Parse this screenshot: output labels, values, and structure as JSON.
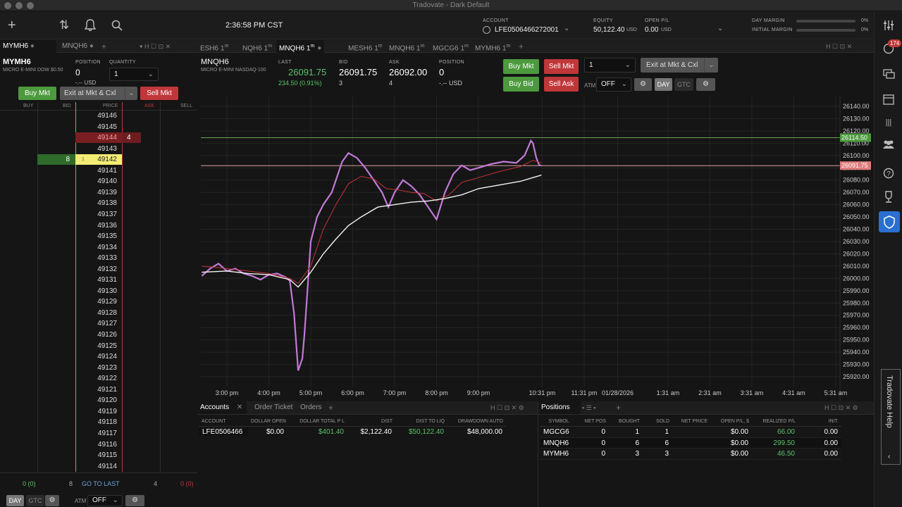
{
  "window": {
    "title": "Tradovate - Dark Default"
  },
  "topbar": {
    "clock": "2:36:58 PM CST",
    "account_label": "ACCOUNT",
    "account_value": "LFE0506466272001",
    "equity_label": "EQUITY",
    "equity_value": "50,122.40",
    "equity_unit": "USD",
    "openpl_label": "OPEN P/L",
    "openpl_value": "0.00",
    "openpl_unit": "USD",
    "day_margin_label": "DAY MARGIN",
    "day_margin_pct": "0%",
    "initial_margin_label": "INITIAL MARGIN",
    "initial_margin_pct": "0%"
  },
  "rightbar": {
    "badge": "174",
    "help_label": "Tradovate Help"
  },
  "left_tabs": [
    {
      "label": "MYMH6",
      "active": true
    },
    {
      "label": "MNQH6",
      "active": false
    }
  ],
  "order_panel": {
    "symbol": "MYMH6",
    "subtitle": "MICRO E-MINI DOW $0.50",
    "position_label": "POSITION",
    "position_value": "0",
    "position_usd": "-.-- USD",
    "quantity_label": "QUANTITY",
    "quantity_value": "1",
    "buy_mkt": "Buy Mkt",
    "exit_cxl": "Exit at Mkt & Cxl",
    "sell_mkt": "Sell Mkt"
  },
  "dom": {
    "headers": {
      "buy": "BUY",
      "bid": "BID",
      "price": "PRICE",
      "ask": "ASK",
      "sell": "SELL"
    },
    "prices": [
      "49146",
      "49145",
      "49144",
      "49143",
      "49142",
      "49141",
      "49140",
      "49139",
      "49138",
      "49137",
      "49136",
      "49135",
      "49134",
      "49133",
      "49132",
      "49131",
      "49130",
      "49129",
      "49128",
      "49127",
      "49126",
      "49125",
      "49124",
      "49123",
      "49122",
      "49121",
      "49120",
      "49119",
      "49118",
      "49117",
      "49116",
      "49115",
      "49114"
    ],
    "ask_price_row": "49144",
    "ask_size": "4",
    "bid_price_row": "49142",
    "bid_size": "8",
    "last_marker": "1",
    "footer_left": "0 (0)",
    "footer_bid_total": "8",
    "go_to_last": "GO TO LAST",
    "footer_ask_total": "4",
    "footer_right": "0 (0)",
    "tif_day": "DAY",
    "tif_gtc": "GTC",
    "atm_label": "ATM",
    "atm_value": "OFF"
  },
  "chart_tabs": [
    {
      "label": "ESH6 1",
      "sup": "m",
      "active": false
    },
    {
      "label": "NQH6 1",
      "sup": "m",
      "active": false
    },
    {
      "label": "MNQH6 1",
      "sup": "m",
      "active": true
    },
    {
      "label": "MESH6 1",
      "sup": "m",
      "active": false
    },
    {
      "label": "MNQH6 1",
      "sup": "m",
      "active": false
    },
    {
      "label": "MGCG6 1",
      "sup": "m",
      "active": false
    },
    {
      "label": "MYMH6 1",
      "sup": "m",
      "active": false
    }
  ],
  "quote": {
    "symbol": "MNQH6",
    "subtitle": "MICRO E-MINI NASDAQ-100",
    "last_label": "LAST",
    "last_value": "26091.75",
    "change": "234.50 (0.91%)",
    "bid_label": "BID",
    "bid_value": "26091.75",
    "bid_size": "3",
    "ask_label": "ASK",
    "ask_value": "26092.00",
    "ask_size": "4",
    "position_label": "POSITION",
    "position_value": "0",
    "position_usd": "-.-- USD",
    "buy_mkt": "Buy Mkt",
    "sell_mkt": "Sell Mkt",
    "buy_bid": "Buy Bid",
    "sell_ask": "Sell Ask",
    "quantity_value": "1",
    "exit_cxl": "Exit at Mkt & Cxl",
    "atm_label": "ATM",
    "atm_value": "OFF",
    "tif_day": "DAY",
    "tif_gtc": "GTC"
  },
  "chart_data": {
    "type": "line",
    "title": "",
    "xlabel": "",
    "ylabel": "",
    "ylim": [
      25912,
      26148
    ],
    "grid": true,
    "x_ticks": [
      "3:00 pm",
      "4:00 pm",
      "5:00 pm",
      "6:00 pm",
      "7:00 pm",
      "8:00 pm",
      "9:00 pm",
      "10:31 pm",
      "11:31 pm",
      "01/28/2026",
      "1:31 am",
      "2:31 am",
      "3:31 am",
      "4:31 am",
      "5:31 am"
    ],
    "y_ticks": [
      26140,
      26130,
      26120,
      26110,
      26100,
      26090,
      26080,
      26070,
      26060,
      26050,
      26040,
      26030,
      26020,
      26010,
      26000,
      25990,
      25980,
      25970,
      25960,
      25950,
      25940,
      25930,
      25920
    ],
    "last_price": 26091.75,
    "last_price_label": "26091.75",
    "upper_line": 26114.5,
    "upper_line_label": "26114.50",
    "x_hours": [
      0,
      1,
      2,
      3,
      4,
      5,
      6,
      7.52,
      8.52,
      9.32,
      10.52,
      11.52,
      12.52,
      13.52,
      14.52
    ],
    "price_path": [
      [
        -0.6,
        26002
      ],
      [
        -0.4,
        26008
      ],
      [
        -0.2,
        26012
      ],
      [
        0,
        26006
      ],
      [
        0.2,
        26008
      ],
      [
        0.4,
        26004
      ],
      [
        0.6,
        26002
      ],
      [
        0.8,
        25999
      ],
      [
        1,
        26003
      ],
      [
        1.2,
        26004
      ],
      [
        1.4,
        26001
      ],
      [
        1.5,
        25998
      ],
      [
        1.6,
        25972
      ],
      [
        1.7,
        25925
      ],
      [
        1.8,
        25935
      ],
      [
        1.85,
        25955
      ],
      [
        1.9,
        25980
      ],
      [
        2,
        26030
      ],
      [
        2.15,
        26050
      ],
      [
        2.3,
        26060
      ],
      [
        2.5,
        26070
      ],
      [
        2.6,
        26080
      ],
      [
        2.75,
        26095
      ],
      [
        2.9,
        26102
      ],
      [
        3.1,
        26098
      ],
      [
        3.3,
        26090
      ],
      [
        3.5,
        26080
      ],
      [
        3.7,
        26070
      ],
      [
        3.85,
        26058
      ],
      [
        4,
        26070
      ],
      [
        4.2,
        26080
      ],
      [
        4.4,
        26075
      ],
      [
        4.6,
        26068
      ],
      [
        4.8,
        26058
      ],
      [
        5,
        26048
      ],
      [
        5.2,
        26070
      ],
      [
        5.4,
        26085
      ],
      [
        5.6,
        26092
      ],
      [
        5.8,
        26088
      ],
      [
        6,
        26090
      ],
      [
        6.3,
        26093
      ],
      [
        6.6,
        26095
      ],
      [
        6.9,
        26094
      ],
      [
        7.1,
        26100
      ],
      [
        7.25,
        26112
      ],
      [
        7.3,
        26110
      ],
      [
        7.38,
        26098
      ],
      [
        7.45,
        26092
      ],
      [
        7.5,
        26091.75
      ]
    ],
    "sma_fast": [
      [
        -0.6,
        26010
      ],
      [
        0,
        26008
      ],
      [
        0.5,
        26006
      ],
      [
        1,
        26004
      ],
      [
        1.5,
        26000
      ],
      [
        1.7,
        25996
      ],
      [
        2,
        26010
      ],
      [
        2.3,
        26040
      ],
      [
        2.6,
        26060
      ],
      [
        2.9,
        26077
      ],
      [
        3.2,
        26083
      ],
      [
        3.5,
        26081
      ],
      [
        3.8,
        26073
      ],
      [
        4.1,
        26072
      ],
      [
        4.4,
        26070
      ],
      [
        4.7,
        26069
      ],
      [
        5,
        26063
      ],
      [
        5.3,
        26068
      ],
      [
        5.6,
        26078
      ],
      [
        6,
        26082
      ],
      [
        6.5,
        26087
      ],
      [
        7,
        26091
      ],
      [
        7.3,
        26096
      ],
      [
        7.5,
        26094
      ]
    ],
    "sma_slow": [
      [
        -0.6,
        26005
      ],
      [
        0,
        26006
      ],
      [
        0.5,
        26004
      ],
      [
        1,
        26003
      ],
      [
        1.5,
        25999
      ],
      [
        1.7,
        25993
      ],
      [
        2,
        26005
      ],
      [
        2.3,
        26020
      ],
      [
        2.6,
        26032
      ],
      [
        2.9,
        26043
      ],
      [
        3.2,
        26050
      ],
      [
        3.6,
        26058
      ],
      [
        4,
        26060
      ],
      [
        4.4,
        26062
      ],
      [
        4.8,
        26063
      ],
      [
        5.2,
        26065
      ],
      [
        5.6,
        26068
      ],
      [
        6,
        26073
      ],
      [
        6.5,
        26076
      ],
      [
        7,
        26079
      ],
      [
        7.3,
        26082
      ],
      [
        7.5,
        26084
      ]
    ]
  },
  "accounts_panel": {
    "tabs": [
      "Accounts",
      "Order Ticket",
      "Orders"
    ],
    "headers": [
      "ACCOUNT",
      "DOLLAR OPEN P",
      "DOLLAR TOTAL P L",
      "DIST",
      "DIST TO LIQ",
      "DRAWDOWN AUTO"
    ],
    "row": [
      "LFE0506466",
      "$0.00",
      "$401.40",
      "$2,122.40",
      "$50,122.40",
      "$48,000.00"
    ]
  },
  "positions_panel": {
    "title": "Positions",
    "headers": [
      "SYMBOL",
      "NET POS",
      "BOUGHT",
      "SOLD",
      "NET PRICE",
      "OPEN P/L, $",
      "REALIZED P/L",
      "INIT."
    ],
    "rows": [
      [
        "MGCG6",
        "0",
        "1",
        "1",
        "",
        "$0.00",
        "66.00",
        "0.00"
      ],
      [
        "MNQH6",
        "0",
        "6",
        "6",
        "",
        "$0.00",
        "299.50",
        "0.00"
      ],
      [
        "MYMH6",
        "0",
        "3",
        "3",
        "",
        "$0.00",
        "46.50",
        "0.00"
      ]
    ]
  },
  "colors": {
    "green": "#4c9a3d",
    "red": "#c0373a",
    "price_green": "#5cc36b",
    "candle": "#c17ad6",
    "bg": "#151515"
  }
}
